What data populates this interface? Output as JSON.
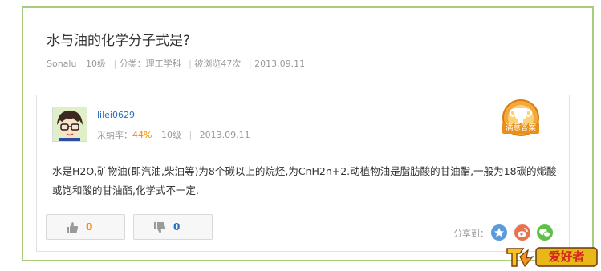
{
  "question": {
    "title": "水与油的化学分子式是?",
    "author": "Sonalu",
    "level": "10级",
    "category": "分类：理工学科",
    "views": "被浏览47次",
    "date": "2013.09.11"
  },
  "answer": {
    "username": "lilei0629",
    "rate_label": "采纳率：",
    "rate_value": "44%",
    "level": "10级",
    "date": "2013.09.11",
    "badge_label": "满意答案",
    "text": "水是H2O,矿物油(即汽油,柴油等)为8个碳以上的烷烃,为CnH2n+2.动植物油是脂肪酸的甘油酯,一般为18碳的烯酸或饱和酸的甘油酯,化学式不一定."
  },
  "votes": {
    "up_count": "0",
    "down_count": "0"
  },
  "share": {
    "label": "分享到："
  },
  "watermark": {
    "text": "爱好者"
  },
  "colors": {
    "frame_border": "#a6cc7c",
    "rate": "#f08a00",
    "username": "#2a6cb5",
    "badge": "#e8901a"
  }
}
